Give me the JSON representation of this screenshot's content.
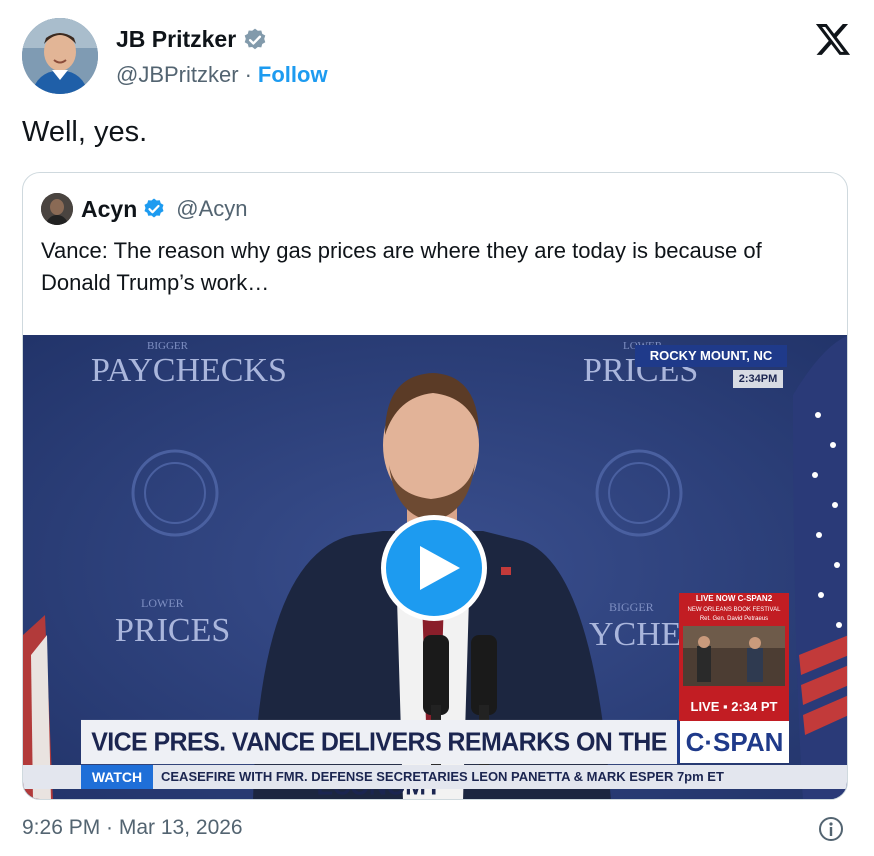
{
  "author": {
    "display_name": "JB Pritzker",
    "handle": "@JBPritzker",
    "separator": "·",
    "follow_label": "Follow",
    "verified": "gray-verified-badge"
  },
  "tweet": {
    "text": "Well, yes.",
    "timestamp": "9:26 PM · Mar 13, 2026"
  },
  "quote": {
    "display_name": "Acyn",
    "handle": "@Acyn",
    "verified": "blue-verified-badge",
    "text": "Vance: The reason why gas prices are where they are today is because of Donald Trump’s work…"
  },
  "video": {
    "backdrop_left_top": "BIGGER",
    "backdrop_left": "PAYCHECKS",
    "backdrop_right_top": "LOWER",
    "backdrop_right": "PRICES",
    "backdrop_left_lower_top": "LOWER",
    "backdrop_left_lower": "PRICES",
    "backdrop_right_lower_top": "BIGGER",
    "backdrop_right_lower": "YCHEC",
    "location": "ROCKY MOUNT, NC",
    "location_time": "2:34PM",
    "live_now": "LIVE NOW C-SPAN2",
    "live_sub1": "NEW ORLEANS BOOK FESTIVAL",
    "live_sub2": "Ret. Gen. David Petraeus",
    "live_time": "LIVE ▪ 2:34 PT",
    "chyron": "VICE PRES. VANCE DELIVERS REMARKS ON THE ECONOMY",
    "network": "C·SPAN",
    "watch_label": "WATCH",
    "ticker": "CEASEFIRE WITH FMR. DEFENSE SECRETARIES LEON PANETTA & MARK ESPER  7pm ET"
  },
  "colors": {
    "link": "#1d9bf0",
    "text_primary": "#0f1419",
    "text_secondary": "#536471",
    "border": "#cfd9de"
  }
}
